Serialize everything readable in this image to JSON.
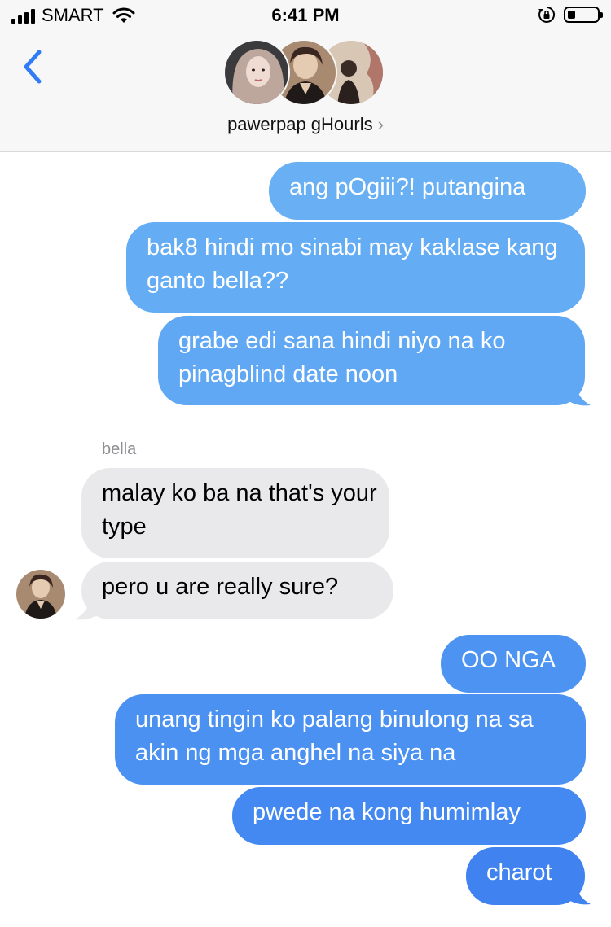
{
  "status_bar": {
    "carrier": "SMART",
    "time": "6:41 PM",
    "signal_bars": 4,
    "battery_level": 0.25
  },
  "header": {
    "group_name": "pawerpap gHourls",
    "icons": [
      "back-chevron-icon",
      "chevron-right-icon",
      "rotation-lock-icon",
      "wifi-icon",
      "battery-icon"
    ]
  },
  "conversation": {
    "outgoing_block_1": [
      "ang pOgiii?! putangina",
      "bak8 hindi mo sinabi may kaklase kang ganto bella??",
      "grabe edi sana hindi niyo na ko pinagblind date noon"
    ],
    "incoming_sender": "bella",
    "incoming": [
      "malay ko ba na that's your type",
      "pero u are really sure?"
    ],
    "outgoing_block_2": [
      "OO NGA",
      "unang tingin ko palang binulong na sa akin ng mga anghel na siya na",
      "pwede na kong humimlay",
      "charot"
    ]
  },
  "colors": {
    "outgoing_light": "#68b0f3",
    "outgoing_dark": "#3f82f0",
    "incoming": "#e9e9eb",
    "ios_blue": "#2f7cf6"
  }
}
